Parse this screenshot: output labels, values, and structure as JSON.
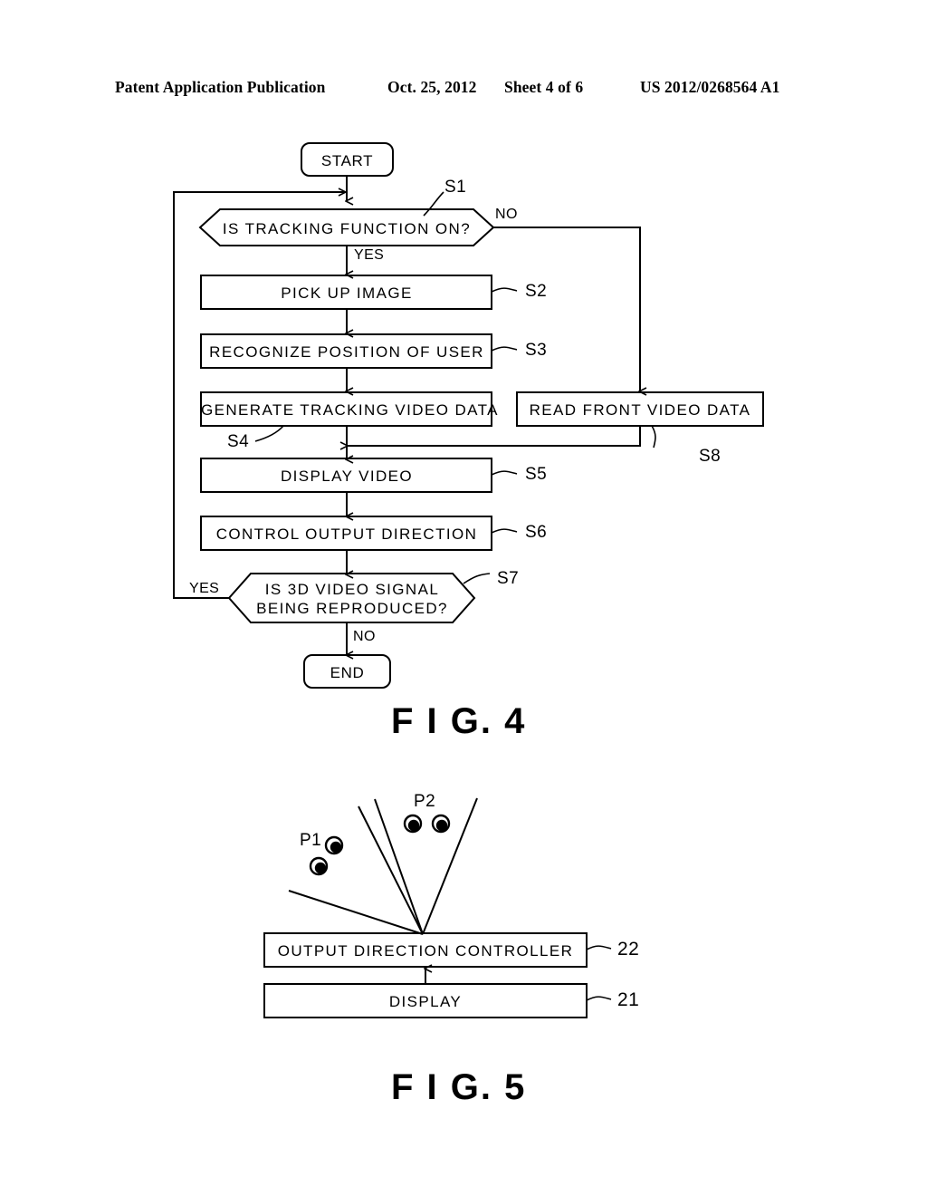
{
  "header": {
    "publication": "Patent Application Publication",
    "date": "Oct. 25, 2012",
    "sheet": "Sheet 4 of 6",
    "doc_number": "US 2012/0268564 A1"
  },
  "figures": [
    {
      "caption": "F I G. 4",
      "type": "flowchart",
      "nodes": {
        "start": "START",
        "s1": "IS  TRACKING  FUNCTION  ON?",
        "s2": "PICK  UP  IMAGE",
        "s3": "RECOGNIZE  POSITION  OF  USER",
        "s4": "GENERATE  TRACKING  VIDEO  DATA",
        "s8": "READ  FRONT  VIDEO  DATA",
        "s5": "DISPLAY  VIDEO",
        "s6": "CONTROL  OUTPUT  DIRECTION",
        "s7_line1": "IS  3D  VIDEO  SIGNAL",
        "s7_line2": "BEING  REPRODUCED?",
        "end": "END"
      },
      "step_ids": {
        "s1": "S1",
        "s2": "S2",
        "s3": "S3",
        "s4": "S4",
        "s5": "S5",
        "s6": "S6",
        "s7": "S7",
        "s8": "S8"
      },
      "edge_labels": {
        "s1_no": "NO",
        "s1_yes": "YES",
        "s7_yes": "YES",
        "s7_no": "NO"
      }
    },
    {
      "caption": "F I G. 5",
      "type": "block-diagram",
      "point_labels": {
        "p1": "P1",
        "p2": "P2"
      },
      "blocks": {
        "controller": "OUTPUT  DIRECTION  CONTROLLER",
        "display": "DISPLAY"
      },
      "reference_numerals": {
        "controller": "22",
        "display": "21"
      }
    }
  ],
  "colors": {
    "ink": "#000000",
    "page": "#ffffff"
  }
}
